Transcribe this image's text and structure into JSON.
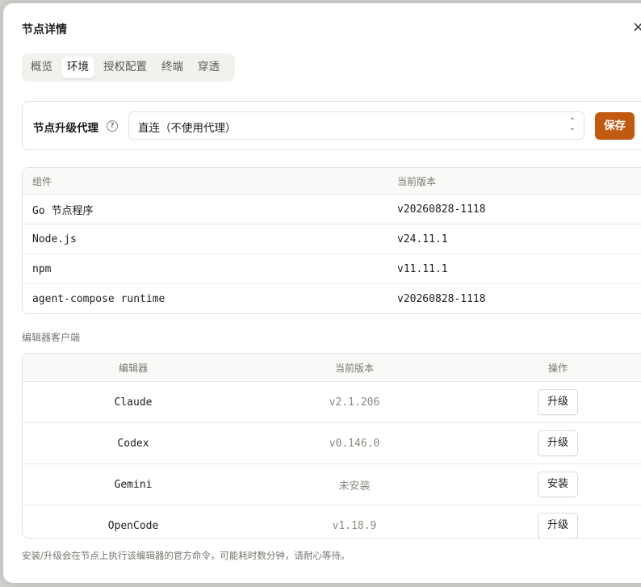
{
  "dialog": {
    "title": "节点详情",
    "close_symbol": "×"
  },
  "tabs": [
    {
      "label": "概览",
      "active": false
    },
    {
      "label": "环境",
      "active": true
    },
    {
      "label": "授权配置",
      "active": false
    },
    {
      "label": "终端",
      "active": false
    },
    {
      "label": "穿透",
      "active": false
    }
  ],
  "proxy": {
    "label": "节点升级代理",
    "help_symbol": "?",
    "selected_value": "直连（不使用代理）",
    "save_label": "保存"
  },
  "components": {
    "headers": [
      "组件",
      "当前版本"
    ],
    "rows": [
      {
        "name": "Go 节点程序",
        "version": "v20260828-1118"
      },
      {
        "name": "Node.js",
        "version": "v24.11.1"
      },
      {
        "name": "npm",
        "version": "v11.11.1"
      },
      {
        "name": "agent-compose runtime",
        "version": "v20260828-1118"
      }
    ]
  },
  "editors": {
    "section_label": "编辑器客户端",
    "headers": [
      "编辑器",
      "当前版本",
      "操作"
    ],
    "rows": [
      {
        "name": "Claude",
        "version": "v2.1.206",
        "action": "升级"
      },
      {
        "name": "Codex",
        "version": "v0.146.0",
        "action": "升级"
      },
      {
        "name": "Gemini",
        "version": "未安装",
        "action": "安装"
      },
      {
        "name": "OpenCode",
        "version": "v1.18.9",
        "action": "升级"
      }
    ]
  },
  "footnote": "安装/升级会在节点上执行该编辑器的官方命令，可能耗时数分钟，请耐心等待。",
  "colors": {
    "accent": "#c05a10",
    "tab_bar": "#f2f1ed",
    "muted_text": "#77756f"
  },
  "icons": {
    "close": "close-icon",
    "help": "help-circle-icon",
    "select": "chevron-up-down-icon"
  }
}
